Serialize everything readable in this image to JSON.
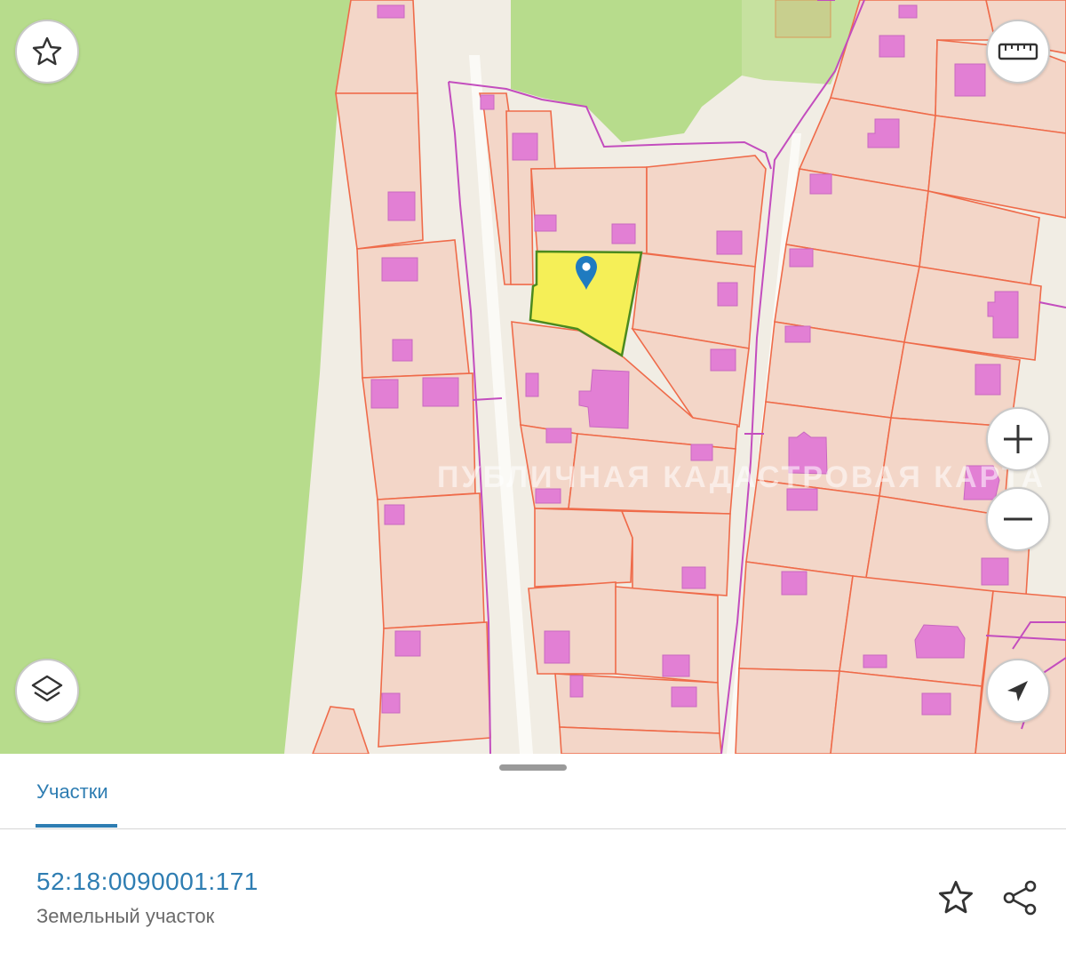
{
  "map": {
    "watermark": "ПУБЛИЧНАЯ КАДАСТРОВАЯ КАРТА",
    "controls": {
      "favorite_icon": "star-outline-icon",
      "ruler_icon": "ruler-icon",
      "zoom_in_icon": "plus-icon",
      "zoom_out_icon": "minus-icon",
      "layers_icon": "layers-icon",
      "locate_icon": "navigation-arrow-icon"
    },
    "selected_marker_icon": "location-pin-icon",
    "colors": {
      "forest": "#b7dc8c",
      "ground": "#f1ede4",
      "parcel_fill": "#f3d6c8",
      "parcel_border": "#ef6b4a",
      "building": "#e27fd4",
      "district_border": "#c34dbe",
      "selected_fill": "#f5ef57",
      "selected_border": "#4b8a1e",
      "marker": "#1f7bc0"
    }
  },
  "sheet": {
    "tabs": [
      {
        "label": "Участки",
        "active": true
      }
    ],
    "parcel": {
      "cadastral_number": "52:18:0090001:171",
      "type": "Земельный участок"
    },
    "actions": {
      "favorite_icon": "star-outline-icon",
      "share_icon": "share-icon"
    },
    "accent_color": "#2e7db2"
  }
}
